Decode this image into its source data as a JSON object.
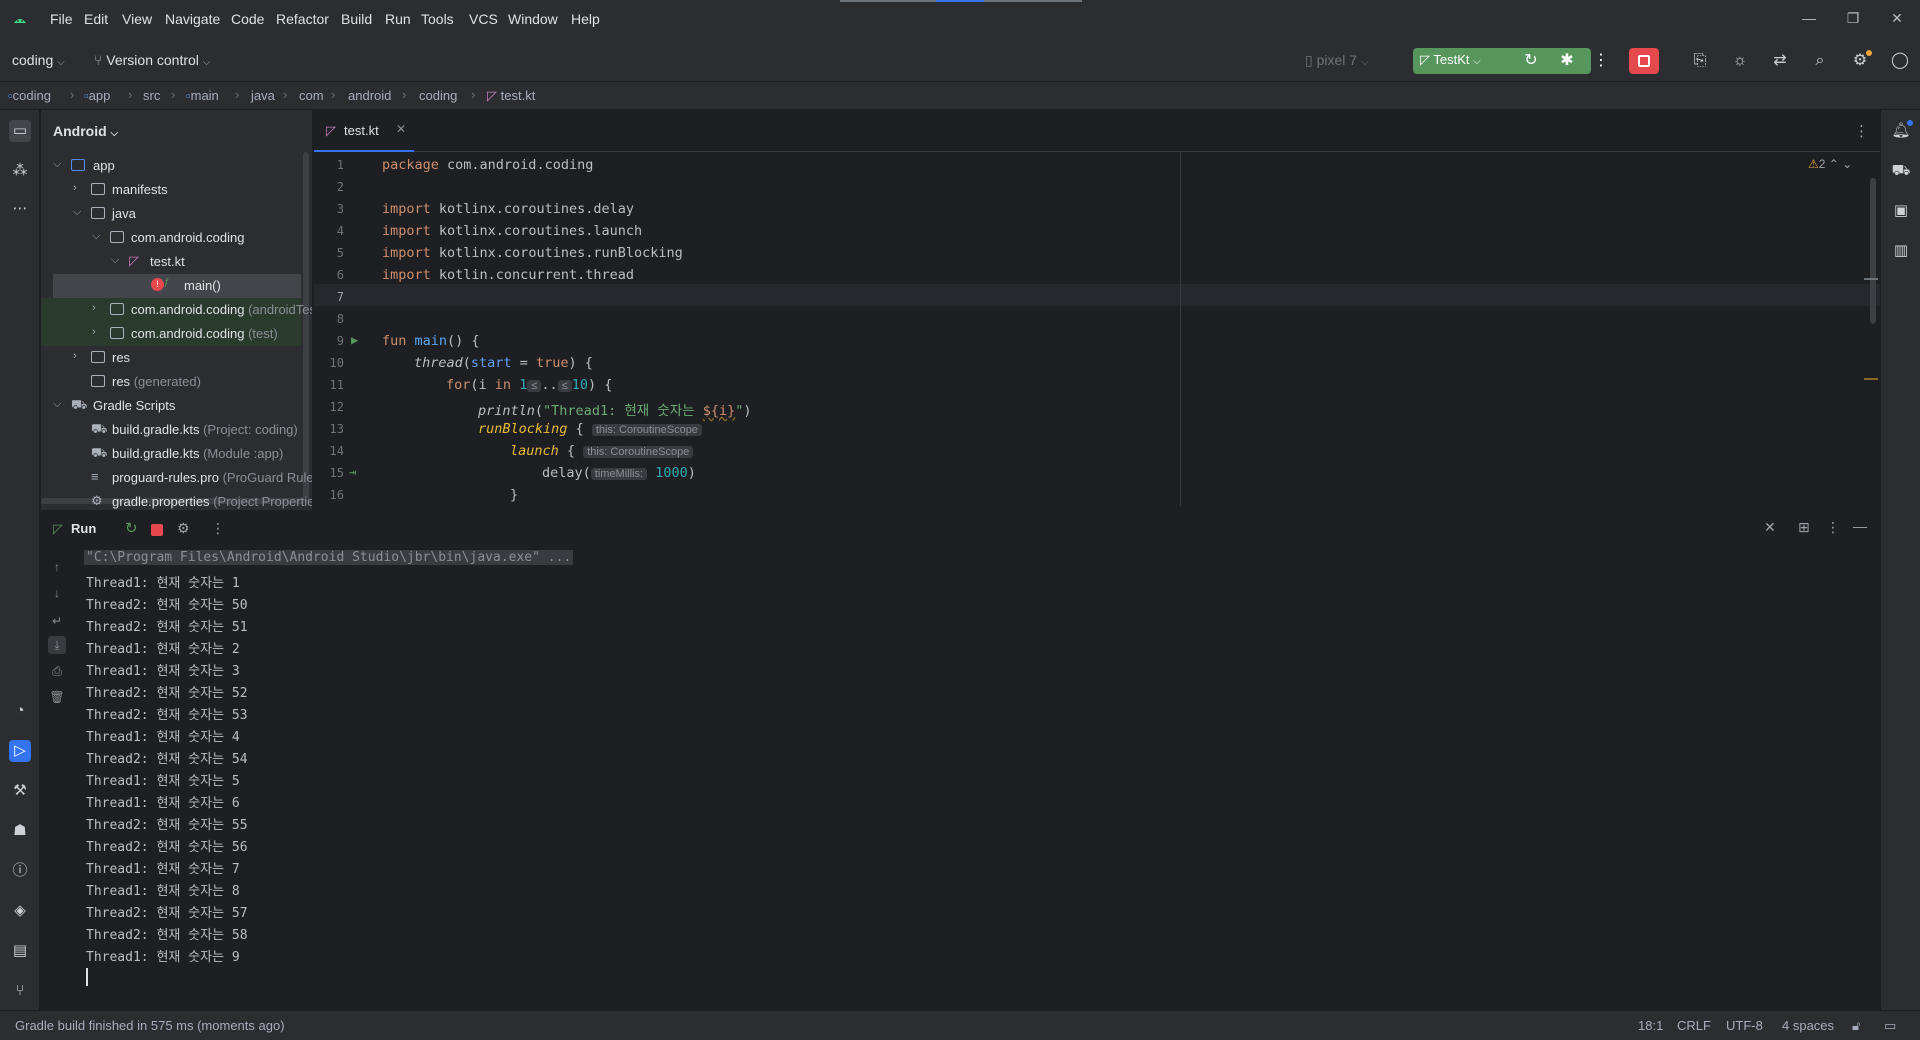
{
  "menu": [
    "File",
    "Edit",
    "View",
    "Navigate",
    "Code",
    "Refactor",
    "Build",
    "Run",
    "Tools",
    "VCS",
    "Window",
    "Help"
  ],
  "toolbar": {
    "project": "coding",
    "vcs": "Version control",
    "device": "pixel 7",
    "run_config": "TestKt"
  },
  "breadcrumb": [
    "coding",
    "app",
    "src",
    "main",
    "java",
    "com",
    "android",
    "coding",
    "test.kt"
  ],
  "project_panel": {
    "view": "Android",
    "items": [
      {
        "label": "app",
        "sub": ""
      },
      {
        "label": "manifests",
        "sub": ""
      },
      {
        "label": "java",
        "sub": ""
      },
      {
        "label": "com.android.coding",
        "sub": ""
      },
      {
        "label": "test.kt",
        "sub": ""
      },
      {
        "label": "main()",
        "sub": ""
      },
      {
        "label": "com.android.coding",
        "sub": "(androidTest)"
      },
      {
        "label": "com.android.coding",
        "sub": "(test)"
      },
      {
        "label": "res",
        "sub": ""
      },
      {
        "label": "res",
        "sub": "(generated)"
      },
      {
        "label": "Gradle Scripts",
        "sub": ""
      },
      {
        "label": "build.gradle.kts",
        "sub": "(Project: coding)"
      },
      {
        "label": "build.gradle.kts",
        "sub": "(Module :app)"
      },
      {
        "label": "proguard-rules.pro",
        "sub": "(ProGuard Rules for \":app\")"
      },
      {
        "label": "gradle.properties",
        "sub": "(Project Properties)"
      }
    ]
  },
  "editor": {
    "tab": "test.kt",
    "warnings": "2",
    "line_numbers": [
      "1",
      "2",
      "3",
      "4",
      "5",
      "6",
      "7",
      "8",
      "9",
      "10",
      "11",
      "12",
      "13",
      "14",
      "15",
      "16"
    ],
    "code": {
      "l1_kw": "package",
      "l1_rest": " com.android.coding",
      "l3_kw": "import",
      "l3_rest": " kotlinx.coroutines.delay",
      "l4_kw": "import",
      "l4_rest": " kotlinx.coroutines.launch",
      "l5_kw": "import",
      "l5_rest": " kotlinx.coroutines.runBlocking",
      "l6_kw": "import",
      "l6_rest": " kotlin.concurrent.thread",
      "l9_kw": "fun",
      "l9_fn": "main",
      "l9_rest": "() {",
      "l10_call": "thread",
      "l10_open": "(",
      "l10_named": "start",
      "l10_eq": " = ",
      "l10_true": "true",
      "l10_close": ") {",
      "l11_kw": "for",
      "l11_a": "(i ",
      "l11_in": "in",
      "l11_b": " ",
      "l11_one": "1",
      "l11_hint1": "≤",
      "l11_dots": "..",
      "l11_hint2": "≤",
      "l11_ten": "10",
      "l11_c": ") {",
      "l12_call": "println",
      "l12_open": "(",
      "l12_str": "\"Thread1: 현재 숫자는 ",
      "l12_tmpl": "${i}",
      "l12_str2": "\"",
      "l12_close": ")",
      "l13_call": "runBlocking",
      "l13_rest": " {",
      "l13_hint": "this: CoroutineScope",
      "l14_call": "launch",
      "l14_rest": " {",
      "l14_hint": "this: CoroutineScope",
      "l15_call": "delay",
      "l15_open": "(",
      "l15_hint": "timeMillis:",
      "l15_num": "1000",
      "l15_close": ")",
      "l16": "}"
    }
  },
  "run": {
    "title": "Run",
    "command": "\"C:\\Program Files\\Android\\Android Studio\\jbr\\bin\\java.exe\" ...",
    "output": [
      "Thread1: 현재 숫자는 1",
      "Thread2: 현재 숫자는 50",
      "Thread2: 현재 숫자는 51",
      "Thread1: 현재 숫자는 2",
      "Thread1: 현재 숫자는 3",
      "Thread2: 현재 숫자는 52",
      "Thread2: 현재 숫자는 53",
      "Thread1: 현재 숫자는 4",
      "Thread2: 현재 숫자는 54",
      "Thread1: 현재 숫자는 5",
      "Thread1: 현재 숫자는 6",
      "Thread2: 현재 숫자는 55",
      "Thread2: 현재 숫자는 56",
      "Thread1: 현재 숫자는 7",
      "Thread1: 현재 숫자는 8",
      "Thread2: 현재 숫자는 57",
      "Thread2: 현재 숫자는 58",
      "Thread1: 현재 숫자는 9"
    ]
  },
  "status": {
    "message": "Gradle build finished in 575 ms (moments ago)",
    "position": "18:1",
    "line_sep": "CRLF",
    "encoding": "UTF-8",
    "indent": "4 spaces"
  },
  "colors": {
    "accent": "#3574f0",
    "run_button": "#57965c",
    "stop_button": "#e5484d"
  }
}
